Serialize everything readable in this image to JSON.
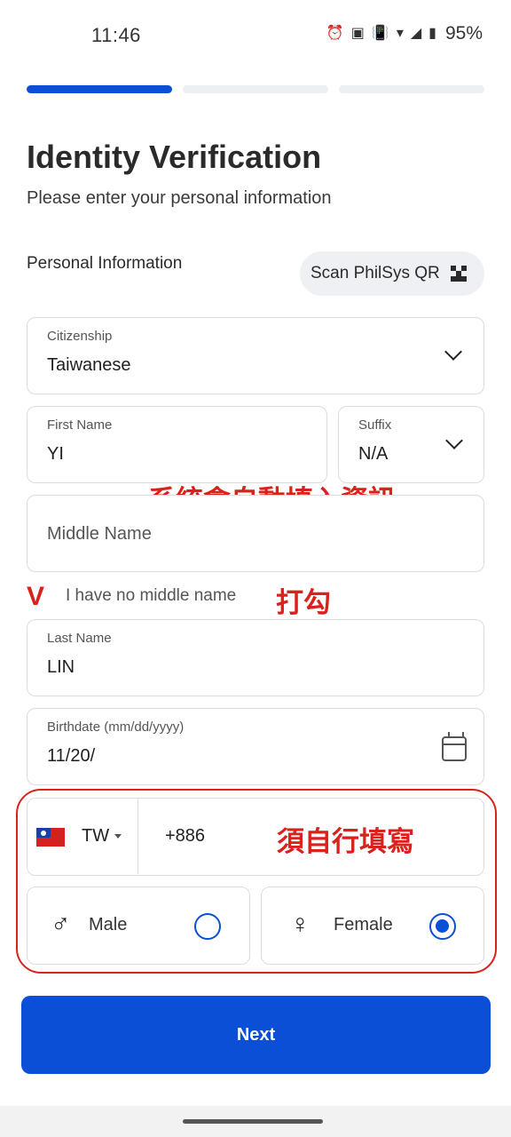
{
  "status_bar": {
    "time": "11:46",
    "battery": "95%",
    "icons": [
      "alarm-icon",
      "auto-icon",
      "vibrate-icon",
      "wifi-icon",
      "signal-icon",
      "battery-icon"
    ],
    "icon_glyphs": {
      "alarm": "⏰",
      "auto": "▣",
      "vibrate": "📳",
      "wifi": "▾",
      "signal": "◢",
      "battery": "▮"
    }
  },
  "progress": {
    "total_steps": 3,
    "current_step": 1
  },
  "header": {
    "title": "Identity Verification",
    "subtitle": "Please enter your personal information"
  },
  "section": {
    "label": "Personal Information",
    "scan_button": "Scan PhilSys QR"
  },
  "form": {
    "citizenship": {
      "label": "Citizenship",
      "value": "Taiwanese"
    },
    "first_name": {
      "label": "First Name",
      "value": "YI"
    },
    "suffix": {
      "label": "Suffix",
      "value": "N/A"
    },
    "middle_name": {
      "placeholder": "Middle Name"
    },
    "no_middle_name": {
      "mark": "V",
      "label": "I have no middle name",
      "checked": true
    },
    "last_name": {
      "label": "Last Name",
      "value": "LIN"
    },
    "birthdate": {
      "label": "Birthdate (mm/dd/yyyy)",
      "value": "11/20/"
    },
    "phone": {
      "country_code": "TW",
      "dial_code": "+886"
    },
    "gender": {
      "male": {
        "label": "Male",
        "icon": "♂",
        "selected": false
      },
      "female": {
        "label": "Female",
        "icon": "♀",
        "selected": true
      }
    }
  },
  "annotations": {
    "auto_fill": "系統會自動填入資訊",
    "check_box": "打勾",
    "fill_yourself": "須自行填寫",
    "color": "#d9221c"
  },
  "actions": {
    "next_label": "Next"
  },
  "colors": {
    "accent": "#0a4fd6",
    "annotation_red": "#d9221c"
  }
}
